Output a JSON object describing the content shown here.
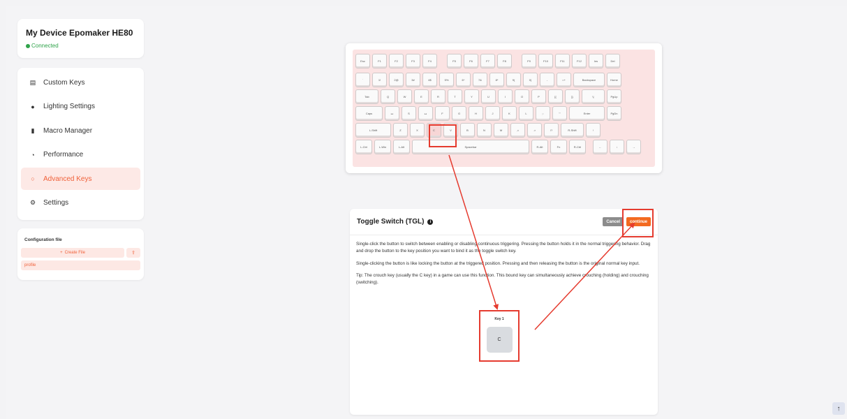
{
  "device": {
    "name": "My Device Epomaker HE80",
    "status": "Connected"
  },
  "nav": {
    "items": [
      {
        "label": "Custom Keys",
        "icon": "keyboard-icon"
      },
      {
        "label": "Lighting Settings",
        "icon": "bulb-icon"
      },
      {
        "label": "Macro Manager",
        "icon": "chart-icon"
      },
      {
        "label": "Performance",
        "icon": "gauge-icon"
      },
      {
        "label": "Advanced Keys",
        "icon": "circle-icon",
        "active": true
      },
      {
        "label": "Settings",
        "icon": "gear-icon"
      }
    ]
  },
  "config": {
    "title": "Configuration file",
    "create_label": "Create File",
    "profile": "profile"
  },
  "keyboard": {
    "rows": [
      [
        "Esc",
        "F1",
        "F2",
        "F3",
        "F4",
        "|",
        "F5",
        "F6",
        "F7",
        "F8",
        "|",
        "F9",
        "F10",
        "F11",
        "F12",
        "Ins",
        "Del"
      ],
      [
        "`",
        "1!",
        "2@",
        "3#",
        "4$",
        "5%",
        "6^",
        "7&",
        "8*",
        "9(",
        "0)",
        "-",
        "=+",
        "Backspace",
        "Home"
      ],
      [
        "Tab",
        "Q",
        "W",
        "E",
        "R",
        "T",
        "Y",
        "U",
        "I",
        "O",
        "P",
        "[{",
        "]}",
        "\\|",
        "PgUp"
      ],
      [
        "Caps",
        "↔",
        "S",
        "↔",
        "F",
        "G",
        "H",
        "J",
        "K",
        "L",
        ";:",
        "'\"",
        "Enter",
        "PgDn"
      ],
      [
        "L-Shift",
        "Z",
        "X",
        "C",
        "V",
        "B",
        "N",
        "M",
        ",<",
        ".>",
        "/?",
        "R-Shift",
        "↑"
      ],
      [
        "L-Ctrl",
        "L-Win",
        "L-Alt",
        "Spacebar",
        "R-Alt",
        "Fn",
        "R-Ctrl",
        "←",
        "↓",
        "→"
      ]
    ]
  },
  "panel": {
    "title": "Toggle Switch (TGL)",
    "cancel_label": "Cancel",
    "continue_label": "continue",
    "paragraphs": [
      "Single-click the button to switch between enabling or disabling continuous triggering. Pressing the button holds it in the normal triggering behavior. Drag and drop the button to the key position you want to bind it as the toggle switch key.",
      "Single-clicking the button is like locking the button at the triggered position. Pressing and then releasing the button is the original normal key input.",
      "Tip: The crouch key (usually the C key) in a game can use this function. This bound key can simultaneously achieve crouching (holding) and crouching (switching)."
    ],
    "slot_label": "Key 1",
    "slot_key": "C"
  },
  "colors": {
    "accent": "#f0613a",
    "connected": "#2fa34a",
    "annotation": "#e53b2f"
  }
}
